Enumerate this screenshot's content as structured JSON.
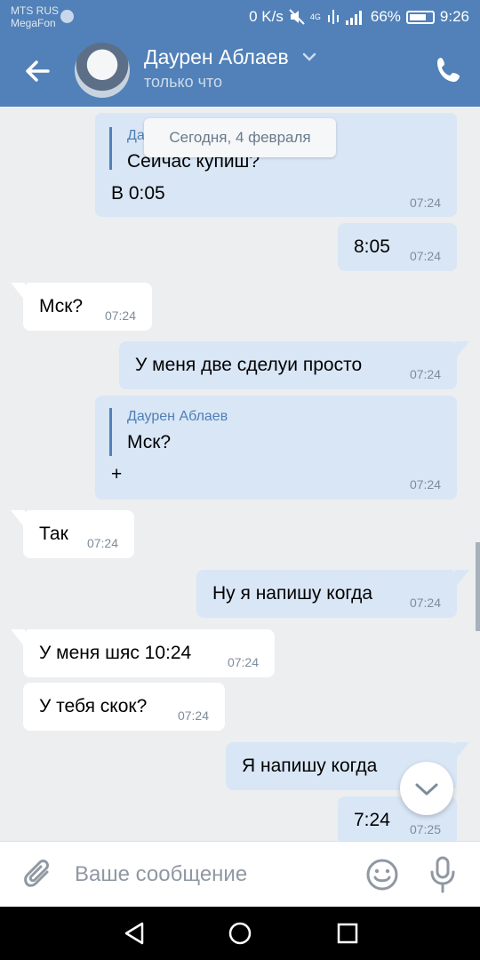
{
  "status_bar": {
    "carrier_1": "MTS RUS",
    "carrier_2": "MegaFon",
    "speed": "0 K/s",
    "network": "4G",
    "battery": "66%",
    "time": "9:26"
  },
  "header": {
    "name": "Даурен Аблаев",
    "status": "только что"
  },
  "date_pill": "Сегодня, 4 февраля",
  "messages": [
    {
      "dir": "out",
      "quote_author": "Да",
      "quote_text": "Сеичас купиш?",
      "text": "В 0:05",
      "time": "07:24"
    },
    {
      "dir": "out",
      "text": "8:05",
      "time": "07:24"
    },
    {
      "dir": "in",
      "text": "Мск?",
      "time": "07:24"
    },
    {
      "dir": "out",
      "text": "У меня две сделуи просто",
      "time": "07:24"
    },
    {
      "dir": "out",
      "quote_author": "Даурен Аблаев",
      "quote_text": "Мск?",
      "text": "+",
      "time": "07:24"
    },
    {
      "dir": "in",
      "text": "Так",
      "time": "07:24"
    },
    {
      "dir": "out",
      "text": "Ну я напишу когда",
      "time": "07:24"
    },
    {
      "dir": "in",
      "text": "У меня шяс 10:24",
      "time": "07:24"
    },
    {
      "dir": "in",
      "text": "У тебя скок?",
      "time": "07:24"
    },
    {
      "dir": "out",
      "text": "Я напишу когда",
      "time": ""
    },
    {
      "dir": "out",
      "text": "7:24",
      "time": "07:25"
    }
  ],
  "composer": {
    "placeholder": "Ваше сообщение"
  },
  "colors": {
    "header": "#5181b8",
    "outgoing_bubble": "#d9e6f6",
    "incoming_bubble": "#ffffff",
    "chat_background": "#edeef0"
  },
  "icons": [
    "back-arrow-icon",
    "chevron-down-icon",
    "phone-icon",
    "paperclip-icon",
    "smile-icon",
    "microphone-icon",
    "scroll-down-chevron-icon",
    "nav-back-icon",
    "nav-home-icon",
    "nav-recents-icon"
  ]
}
